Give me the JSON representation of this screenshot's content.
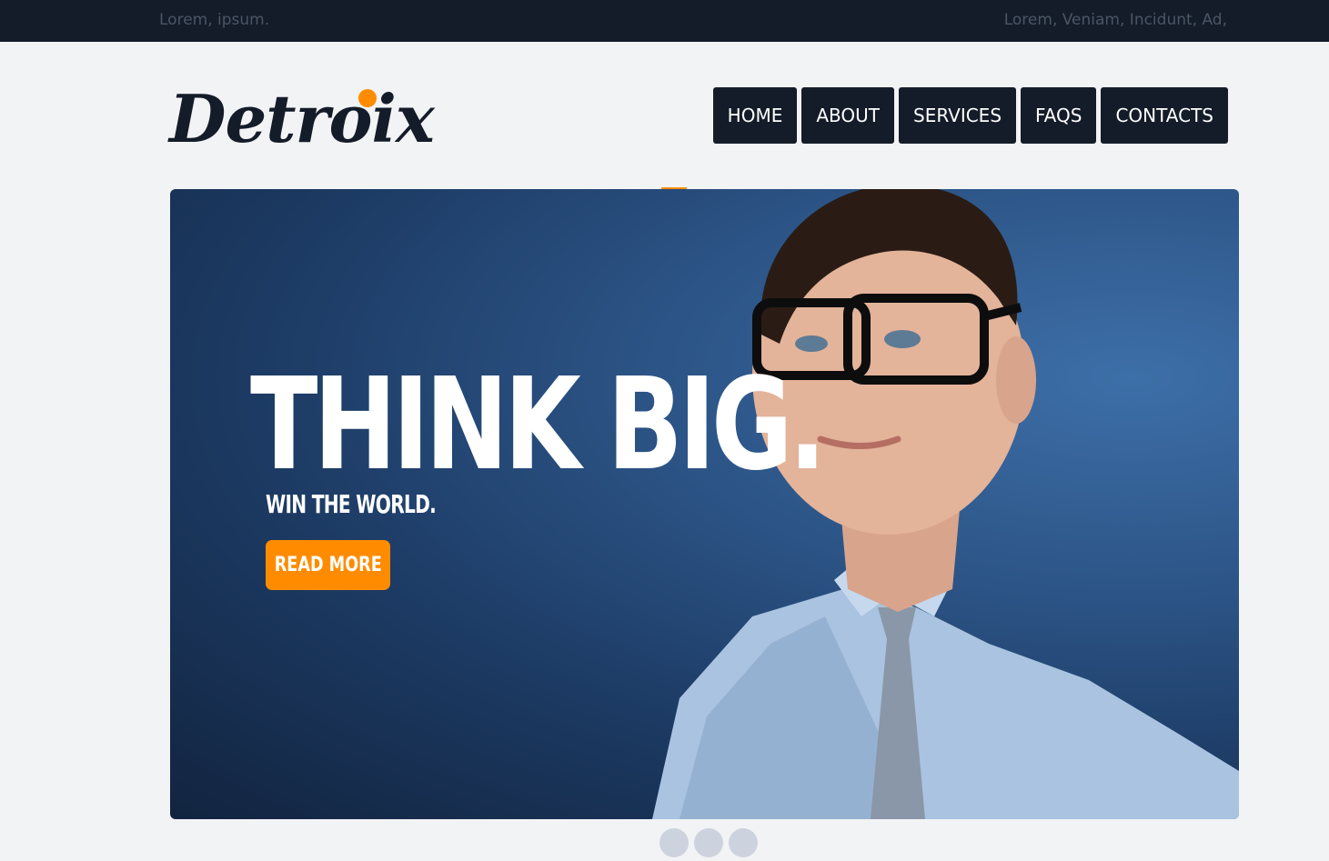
{
  "topbar": {
    "left_text": "Lorem, ipsum.",
    "right_text": "Lorem, Veniam, Incidunt, Ad,"
  },
  "logo": {
    "text": "Detroix",
    "dot_color": "#ff8c00"
  },
  "nav": {
    "items": [
      {
        "label": "HOME"
      },
      {
        "label": "ABOUT"
      },
      {
        "label": "SERVICES"
      },
      {
        "label": "FAQS"
      },
      {
        "label": "CONTACTS"
      }
    ]
  },
  "hero": {
    "title": "THINK BIG.",
    "subtitle": "WIN THE WORLD.",
    "button_label": "READ MORE",
    "accent_color": "#ff8c00"
  },
  "slider": {
    "dots": 3
  },
  "colors": {
    "dark": "#141c29",
    "accent": "#ff8c00",
    "background": "#f2f3f5"
  }
}
